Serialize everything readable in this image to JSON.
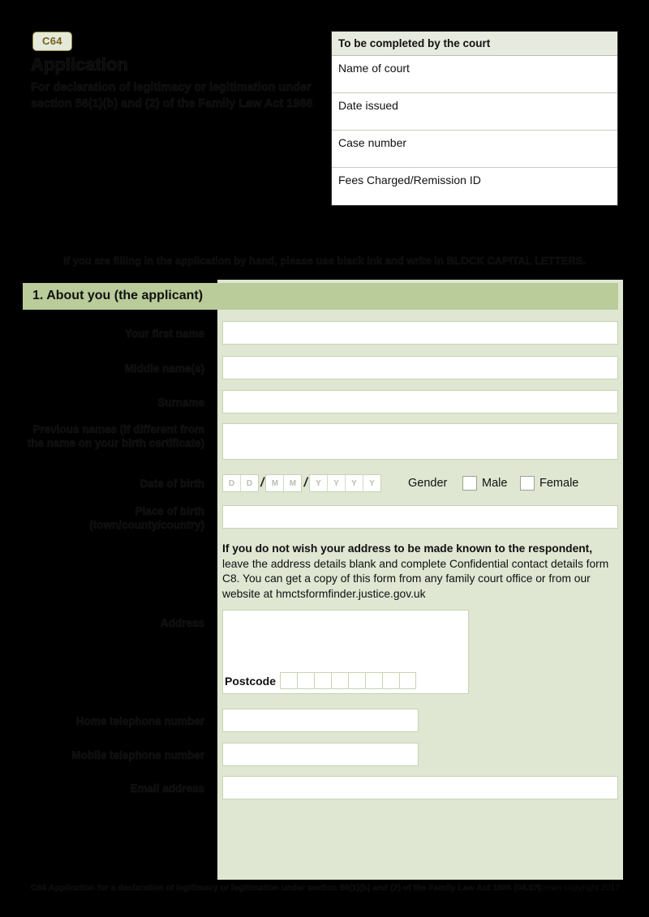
{
  "form": {
    "code_badge": "C64",
    "title": "Application",
    "subtitle": "For declaration of legitimacy or legitimation under section 56(1)(b) and (2) of the Family Law Act 1986",
    "instruction": "If you are filling in the application by hand, please use black ink and write in BLOCK CAPITAL LETTERS."
  },
  "court_table": {
    "header": "To be completed by the court",
    "rows": [
      {
        "label": "Name of court",
        "value": ""
      },
      {
        "label": "Date issued",
        "value": ""
      },
      {
        "label": "Case number",
        "value": ""
      },
      {
        "label": "Fees Charged/Remission ID",
        "value": ""
      }
    ]
  },
  "section": {
    "heading": "1. About you (the applicant)",
    "fields": {
      "first_name": {
        "label": "Your first name",
        "value": ""
      },
      "middle_names": {
        "label": "Middle name(s)",
        "value": ""
      },
      "surname": {
        "label": "Surname",
        "value": ""
      },
      "previous_names": {
        "label": "Previous names (if different from the name on your birth certificate)",
        "value": ""
      },
      "date_of_birth": {
        "label": "Date of birth",
        "placeholders": [
          "D",
          "D",
          "M",
          "M",
          "Y",
          "Y",
          "Y",
          "Y"
        ],
        "separator": "/",
        "value": ""
      },
      "gender": {
        "label": "Gender",
        "options": [
          "Male",
          "Female"
        ],
        "selected": ""
      },
      "place_of_birth": {
        "label": "Place of birth (town/county/country)",
        "value": ""
      },
      "address": {
        "label": "Address",
        "value": ""
      },
      "postcode": {
        "label": "Postcode",
        "value": "",
        "cells": 8
      },
      "home_phone": {
        "label": "Home telephone number",
        "value": ""
      },
      "mobile_phone": {
        "label": "Mobile telephone number",
        "value": ""
      },
      "email": {
        "label": "Email address",
        "value": ""
      }
    },
    "notice": {
      "bold_lead": "If you do not wish your address to be made known to the respondent,",
      "rest": " leave the address details blank and complete Confidential contact details form C8. You can get a copy of this form from any family court office or from our website at hmctsformfinder.justice.gov.uk"
    }
  },
  "footer": {
    "left": "C64 Application for a declaration of legitimacy or legitimation under section 56(1)(b) and (2) of the Family Law Act 1986 (04.17)",
    "right": "© Crown copyright 2017"
  },
  "colors": {
    "page_background": "#000000",
    "panel_green": "#dfe7d3",
    "section_band_green": "#b9cc99",
    "court_header_grey": "#e7eade",
    "badge_background": "#e4ead9",
    "badge_border": "#9a8a42",
    "badge_text": "#7a5f1e",
    "field_border": "#c6d4b2",
    "field_background": "#ffffff"
  }
}
